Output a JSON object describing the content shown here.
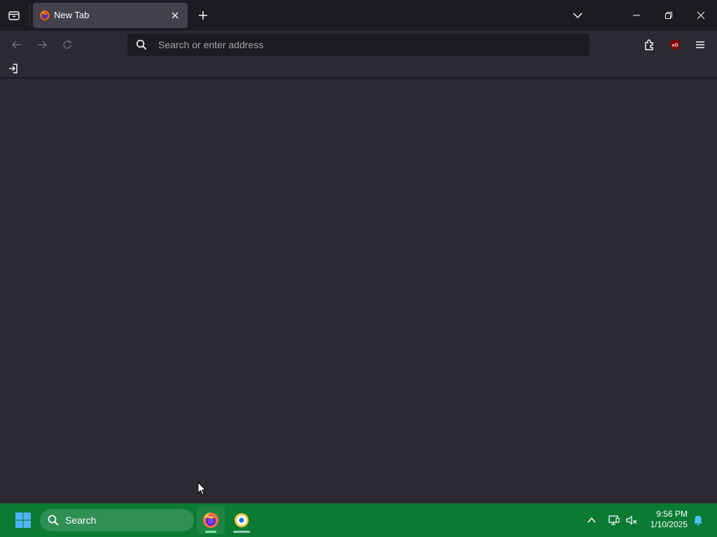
{
  "browser": {
    "tab_list_icon": "tab-list-icon",
    "tabs": [
      {
        "title": "New Tab",
        "favicon": "firefox-icon",
        "active": true
      }
    ],
    "new_tab_icon": "plus-icon",
    "list_all_tabs_icon": "chevron-down-icon",
    "window_controls": [
      "minimize-icon",
      "restore-icon",
      "close-icon"
    ]
  },
  "navbar": {
    "back_icon": "back-arrow-icon",
    "forward_icon": "forward-arrow-icon",
    "reload_icon": "reload-icon",
    "url": {
      "value": "",
      "placeholder": "Search or enter address",
      "icon": "search-icon"
    },
    "toolbar_icons": [
      "extensions-icon",
      "ublock-origin-icon",
      "hamburger-menu-icon"
    ],
    "ublock_badge": "uO"
  },
  "bookmarks": {
    "import_icon": "import-bookmarks-icon"
  },
  "taskbar": {
    "start_icon": "windows-start-icon",
    "search_label": "Search",
    "apps": [
      {
        "name": "Firefox",
        "icon": "firefox-icon",
        "active": true
      },
      {
        "name": "App",
        "icon": "app-icon",
        "active": false
      }
    ],
    "tray_icons": [
      "chevron-up-icon",
      "network-icon",
      "volume-muted-icon"
    ],
    "time": "9:56 PM",
    "date": "1/10/2025",
    "notification_icon": "bell-icon"
  },
  "colors": {
    "tabstrip_bg": "#1c1b22",
    "toolbar_bg": "#2b2a33",
    "active_tab_bg": "#42414d",
    "urlbar_bg": "#1c1b22",
    "taskbar_bg": "#0b7a33",
    "notification_accent": "#4cc2ff"
  }
}
